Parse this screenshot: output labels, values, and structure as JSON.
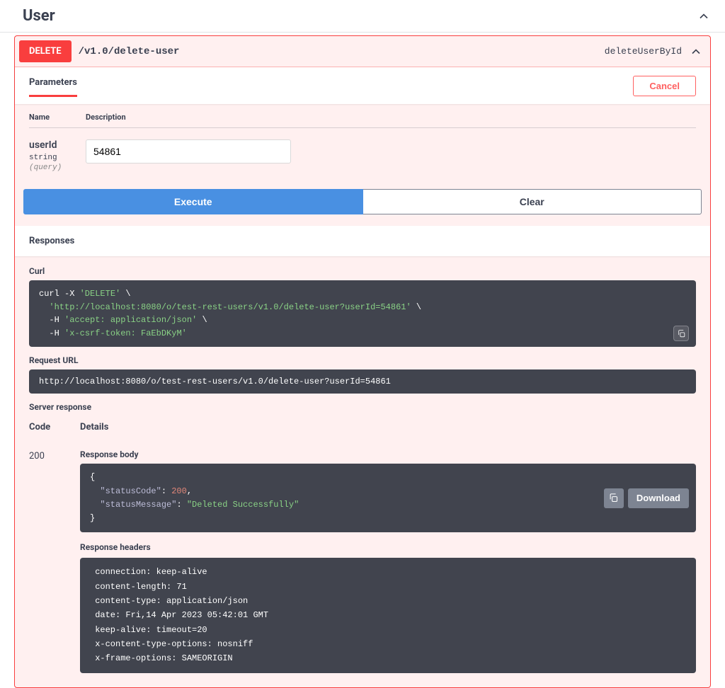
{
  "tag": {
    "name": "User"
  },
  "operation": {
    "method": "DELETE",
    "path": "/v1.0/delete-user",
    "operationId": "deleteUserById"
  },
  "tabs": {
    "parameters": "Parameters",
    "cancel": "Cancel"
  },
  "paramsTable": {
    "nameHeader": "Name",
    "descHeader": "Description"
  },
  "parameter": {
    "name": "userId",
    "type": "string",
    "in": "(query)",
    "value": "54861"
  },
  "buttons": {
    "execute": "Execute",
    "clear": "Clear",
    "download": "Download"
  },
  "responsesHeader": "Responses",
  "labels": {
    "curl": "Curl",
    "requestUrl": "Request URL",
    "serverResponse": "Server response",
    "code": "Code",
    "details": "Details",
    "responseBody": "Response body",
    "responseHeaders": "Response headers"
  },
  "curl": {
    "line1_a": "curl -X ",
    "line1_b": "'DELETE'",
    "line1_c": " \\",
    "line2_a": "  ",
    "line2_b": "'http://localhost:8080/o/test-rest-users/v1.0/delete-user?userId=54861'",
    "line2_c": " \\",
    "line3_a": "  -H ",
    "line3_b": "'accept: application/json'",
    "line3_c": " \\",
    "line4_a": "  -H ",
    "line4_b": "'x-csrf-token: FaEbDKyM'"
  },
  "requestUrl": "http://localhost:8080/o/test-rest-users/v1.0/delete-user?userId=54861",
  "response": {
    "statusCode": "200",
    "body": {
      "open": "{",
      "k1": "\"statusCode\"",
      "colon1": ": ",
      "v1": "200",
      "comma1": ",",
      "k2": "\"statusMessage\"",
      "colon2": ": ",
      "v2": "\"Deleted Successfully\"",
      "close": "}"
    },
    "headers": " connection: keep-alive \n content-length: 71 \n content-type: application/json \n date: Fri,14 Apr 2023 05:42:01 GMT \n keep-alive: timeout=20 \n x-content-type-options: nosniff \n x-frame-options: SAMEORIGIN "
  }
}
